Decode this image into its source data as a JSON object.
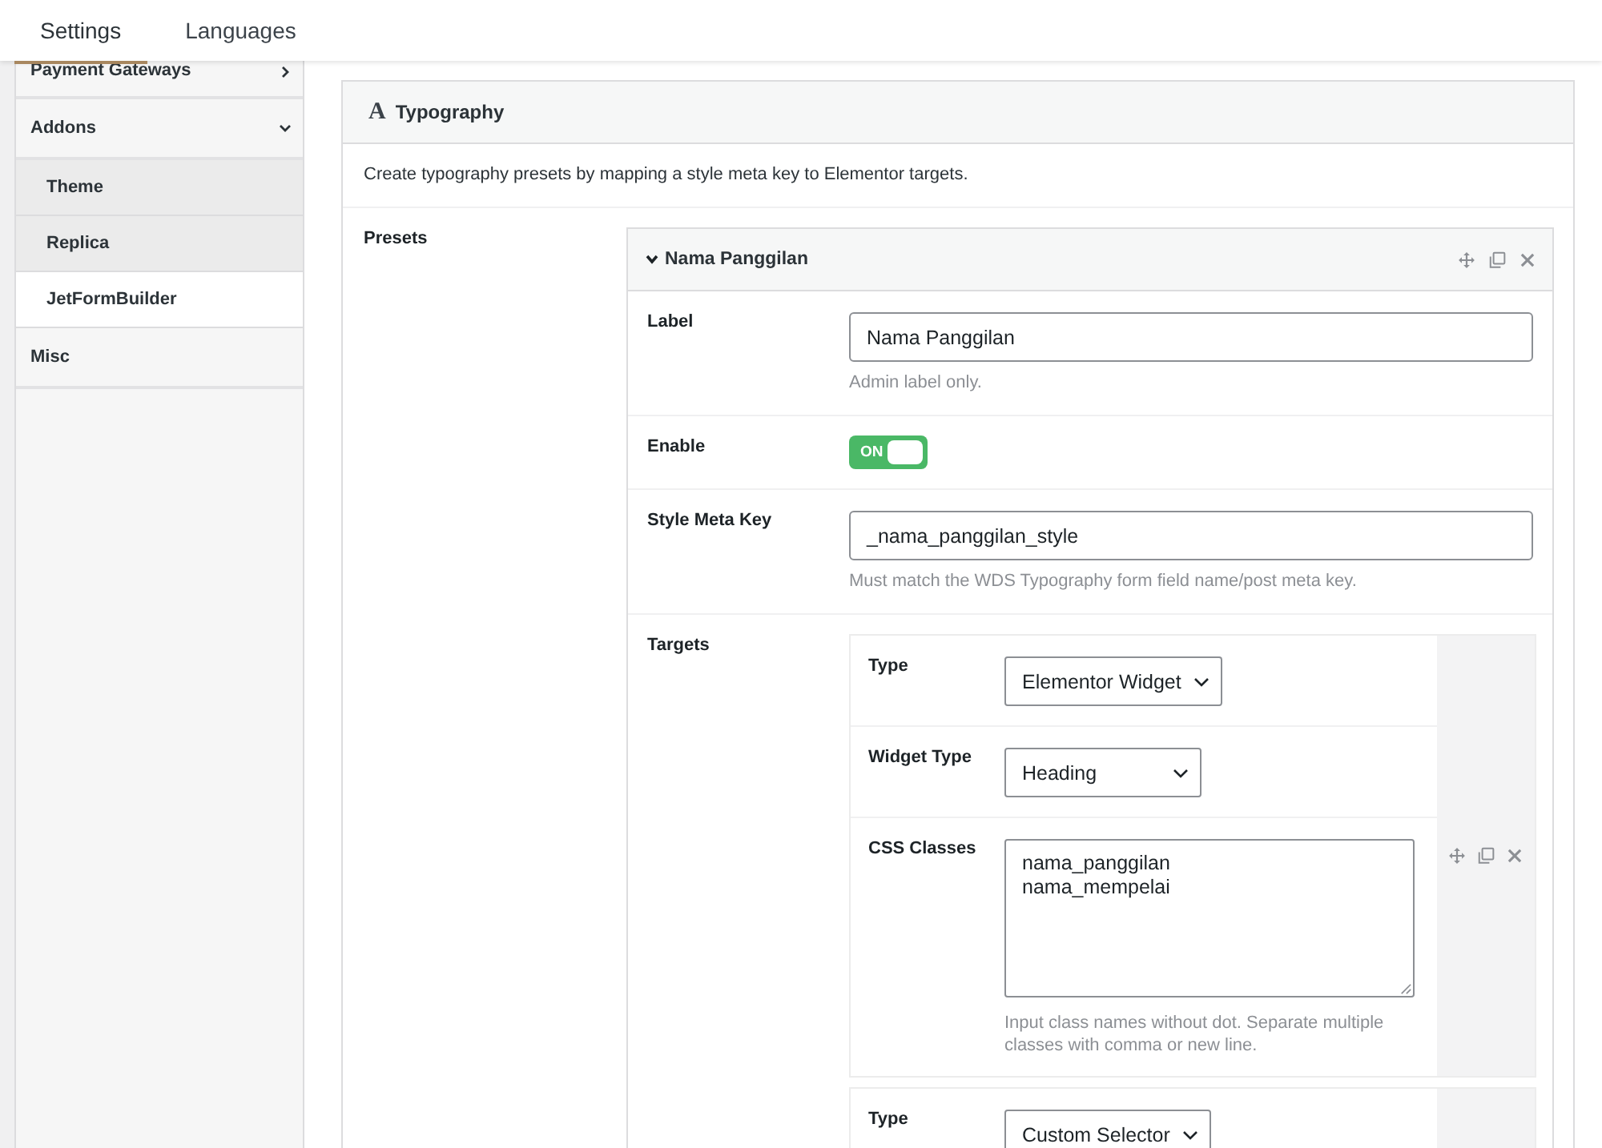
{
  "tabs": [
    {
      "label": "Settings",
      "selected": true
    },
    {
      "label": "Languages",
      "selected": false
    }
  ],
  "sidebar": {
    "items": [
      {
        "label": "Payment Gateways",
        "kind": "group",
        "expanded": false
      },
      {
        "label": "Addons",
        "kind": "group",
        "expanded": true,
        "children": [
          {
            "label": "Theme",
            "selected": false
          },
          {
            "label": "Replica",
            "selected": false
          },
          {
            "label": "JetFormBuilder",
            "selected": true
          }
        ]
      },
      {
        "label": "Misc",
        "kind": "plain"
      }
    ]
  },
  "panel": {
    "icon": "A",
    "title": "Typography",
    "description": "Create typography presets by mapping a style meta key to Elementor targets.",
    "presets_label": "Presets",
    "presets": [
      {
        "title": "Nama Panggilan",
        "expanded": true,
        "fields": [
          {
            "kind": "text",
            "label": "Label",
            "value": "Nama Panggilan",
            "hint": "Admin label only."
          },
          {
            "kind": "toggle",
            "label": "Enable",
            "on": true,
            "text": "ON"
          },
          {
            "kind": "text",
            "label": "Style Meta Key",
            "value": "_nama_panggilan_style",
            "hint": "Must match the WDS Typography form field name/post meta key."
          },
          {
            "kind": "targets",
            "label": "Targets",
            "targets": [
              {
                "actions_visible": true,
                "fields": [
                  {
                    "kind": "select",
                    "label": "Type",
                    "value": "Elementor Widget"
                  },
                  {
                    "kind": "select",
                    "label": "Widget Type",
                    "value": "Heading"
                  },
                  {
                    "kind": "textarea",
                    "label": "CSS Classes",
                    "value": "nama_panggilan\nnama_mempelai",
                    "hint": "Input class names without dot. Separate multiple classes with comma or new line."
                  }
                ]
              },
              {
                "actions_visible": false,
                "fields": [
                  {
                    "kind": "select",
                    "label": "Type",
                    "value": "Custom Selector"
                  }
                ]
              }
            ]
          }
        ]
      }
    ]
  }
}
